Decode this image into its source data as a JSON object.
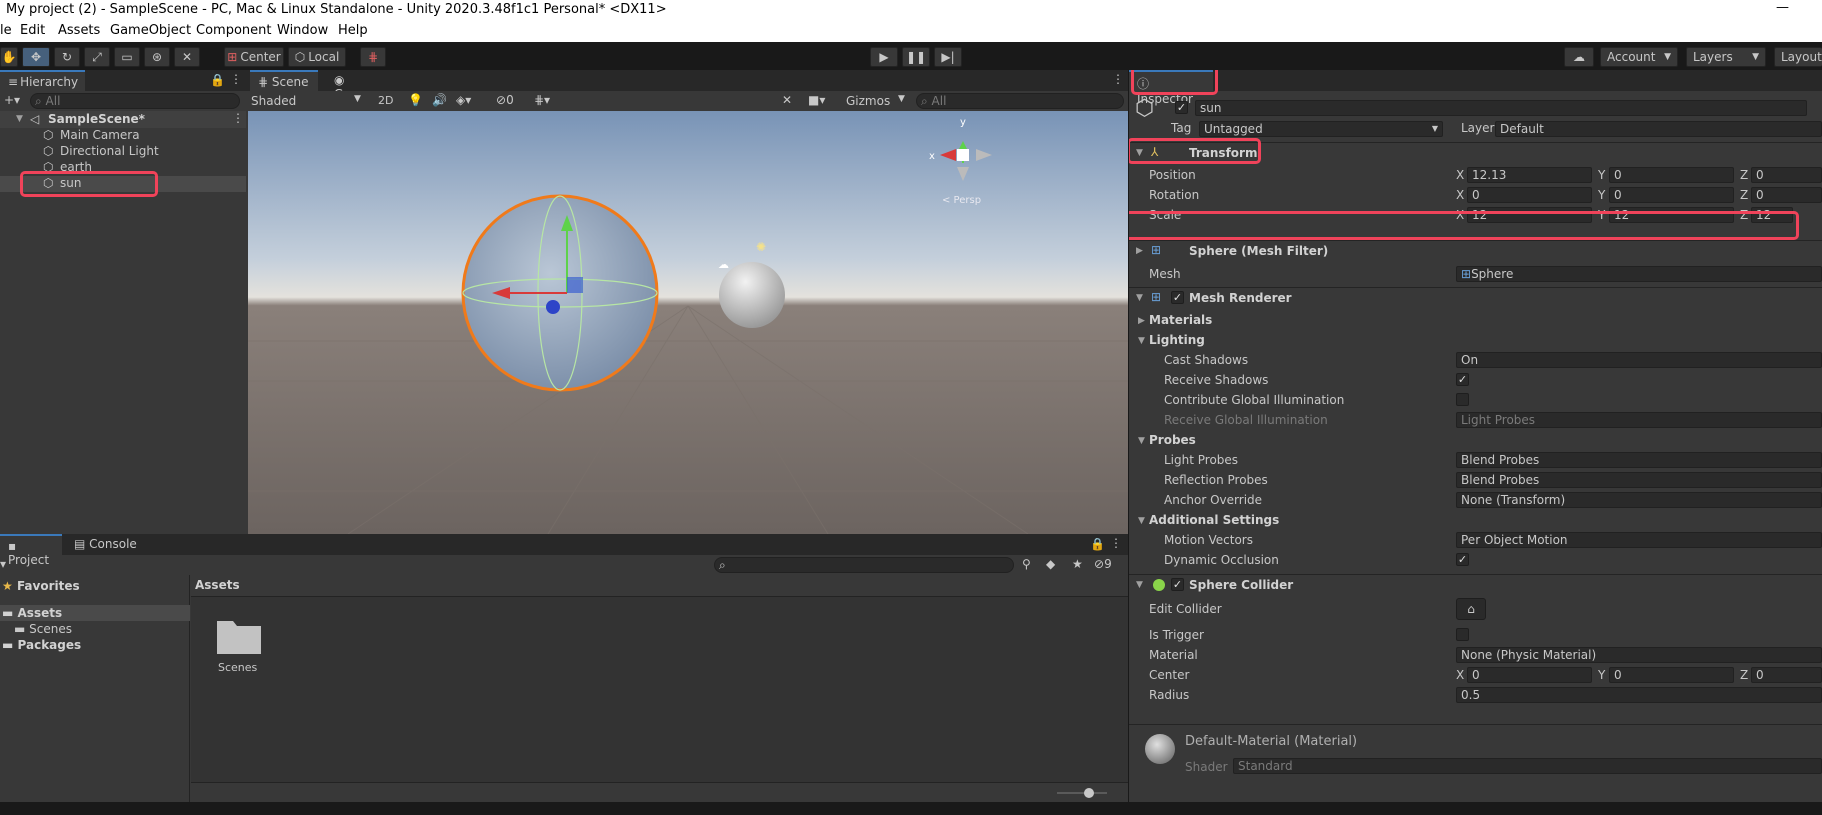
{
  "window": {
    "title": "My project (2) - SampleScene - PC, Mac & Linux Standalone - Unity 2020.3.48f1c1 Personal* <DX11>",
    "minimize": "—"
  },
  "menu": [
    "le",
    "Edit",
    "Assets",
    "GameObject",
    "Component",
    "Window",
    "Help"
  ],
  "toolbar": {
    "pivot_label": "Center",
    "space_label": "Local",
    "account_label": "Account",
    "layers_label": "Layers",
    "layout_label": "Layout"
  },
  "hierarchy": {
    "tab": "Hierarchy",
    "search_placeholder": "All",
    "scene": "SampleScene*",
    "items": [
      "Main Camera",
      "Directional Light",
      "earth",
      "sun"
    ]
  },
  "scene_view": {
    "tabs": [
      "Scene",
      "Game"
    ],
    "shading": "Shaded",
    "mode_2d": "2D",
    "hidden_count": "0",
    "gizmos": "Gizmos",
    "search_placeholder": "All",
    "gizmo_axes": {
      "y": "y",
      "x": "x"
    },
    "persp": "< Persp"
  },
  "project": {
    "tabs": [
      "Project",
      "Console"
    ],
    "favorites": "Favorites",
    "assets": "Assets",
    "scenes": "Scenes",
    "packages": "Packages",
    "breadcrumb": "Assets",
    "folder_label": "Scenes",
    "hidden_count": "9"
  },
  "inspector": {
    "tab": "Inspector",
    "object_name": "sun",
    "tag_label": "Tag",
    "tag_value": "Untagged",
    "layer_label": "Layer",
    "layer_value": "Default",
    "transform": {
      "title": "Transform",
      "position": {
        "label": "Position",
        "x": "12.13",
        "y": "0",
        "z": "0"
      },
      "rotation": {
        "label": "Rotation",
        "x": "0",
        "y": "0",
        "z": "0"
      },
      "scale": {
        "label": "Scale",
        "x": "12",
        "y": "12",
        "z": "12"
      }
    },
    "axis": {
      "x": "X",
      "y": "Y",
      "z": "Z"
    },
    "mesh_filter": {
      "title": "Sphere (Mesh Filter)",
      "mesh_label": "Mesh",
      "mesh_value": "Sphere"
    },
    "mesh_renderer": {
      "title": "Mesh Renderer",
      "materials": "Materials",
      "lighting": "Lighting",
      "cast_shadows": {
        "label": "Cast Shadows",
        "value": "On"
      },
      "receive_shadows": "Receive Shadows",
      "contribute_gi": "Contribute Global Illumination",
      "receive_gi": {
        "label": "Receive Global Illumination",
        "value": "Light Probes"
      },
      "probes": "Probes",
      "light_probes": {
        "label": "Light Probes",
        "value": "Blend Probes"
      },
      "reflection_probes": {
        "label": "Reflection Probes",
        "value": "Blend Probes"
      },
      "anchor_override": {
        "label": "Anchor Override",
        "value": "None (Transform)"
      },
      "additional": "Additional Settings",
      "motion_vectors": {
        "label": "Motion Vectors",
        "value": "Per Object Motion"
      },
      "dynamic_occlusion": "Dynamic Occlusion"
    },
    "sphere_collider": {
      "title": "Sphere Collider",
      "edit_collider": "Edit Collider",
      "is_trigger": "Is Trigger",
      "material_label": "Material",
      "material_value": "None (Physic Material)",
      "center_label": "Center",
      "center": {
        "x": "0",
        "y": "0",
        "z": "0"
      },
      "radius_label": "Radius",
      "radius_value": "0.5"
    },
    "material": {
      "name": "Default-Material (Material)",
      "shader_label": "Shader",
      "shader_value": "Standard"
    }
  },
  "colors": {
    "highlight": "#f0435a",
    "accent": "#3a79bb",
    "selection_outline": "#f07a1a"
  }
}
